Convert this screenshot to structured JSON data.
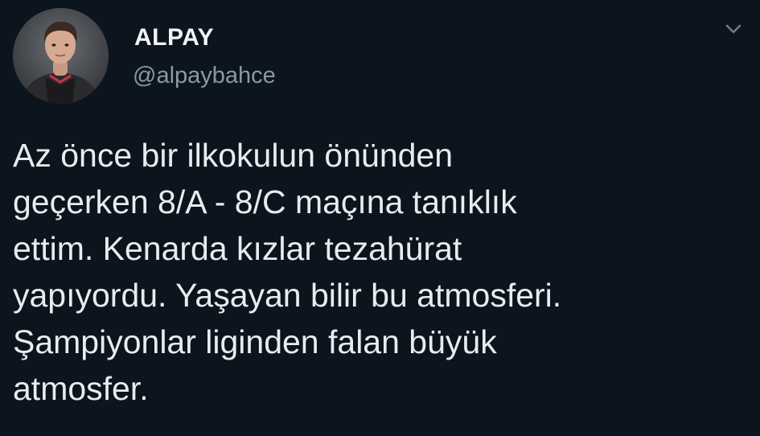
{
  "tweet": {
    "author": {
      "display_name": "ALPAY",
      "handle": "@alpaybahce",
      "avatar_icon": "user-avatar-photo"
    },
    "menu_icon": "chevron-down-icon",
    "text_lines": [
      "Az önce bir ilkokulun önünden",
      "geçerken 8/A - 8/C maçına tanıklık",
      "ettim. Kenarda kızlar tezahürat",
      "yapıyordu. Yaşayan bilir bu atmosferi.",
      "Şampiyonlar liginden falan büyük",
      "atmosfer."
    ]
  },
  "colors": {
    "background": "#0c141d",
    "primary_text": "#e9ecef",
    "secondary_text": "#8899a6"
  }
}
